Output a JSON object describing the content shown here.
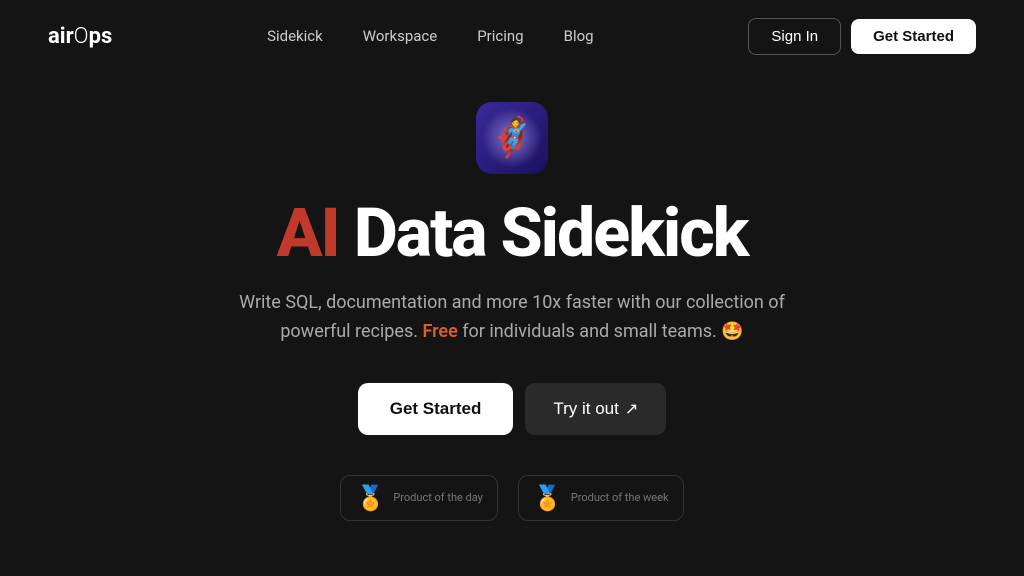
{
  "logo": {
    "text": "airOps"
  },
  "nav": {
    "links": [
      {
        "label": "Sidekick",
        "id": "sidekick"
      },
      {
        "label": "Workspace",
        "id": "workspace"
      },
      {
        "label": "Pricing",
        "id": "pricing"
      },
      {
        "label": "Blog",
        "id": "blog"
      }
    ],
    "signin_label": "Sign In",
    "getstarted_label": "Get Started"
  },
  "hero": {
    "icon_emoji": "🦸",
    "title_ai": "AI",
    "title_rest": " Data Sidekick",
    "subtitle_main": "Write SQL, documentation and more 10x faster with our collection of powerful recipes.",
    "subtitle_free": "Free",
    "subtitle_end": " for individuals and small teams. 🤩",
    "cta_primary": "Get Started",
    "cta_secondary": "Try it out",
    "cta_secondary_icon": "↗️"
  },
  "badges": [
    {
      "label": "Product of the day",
      "medal": "🥇"
    },
    {
      "label": "Product of the week",
      "medal": "🥇"
    }
  ]
}
